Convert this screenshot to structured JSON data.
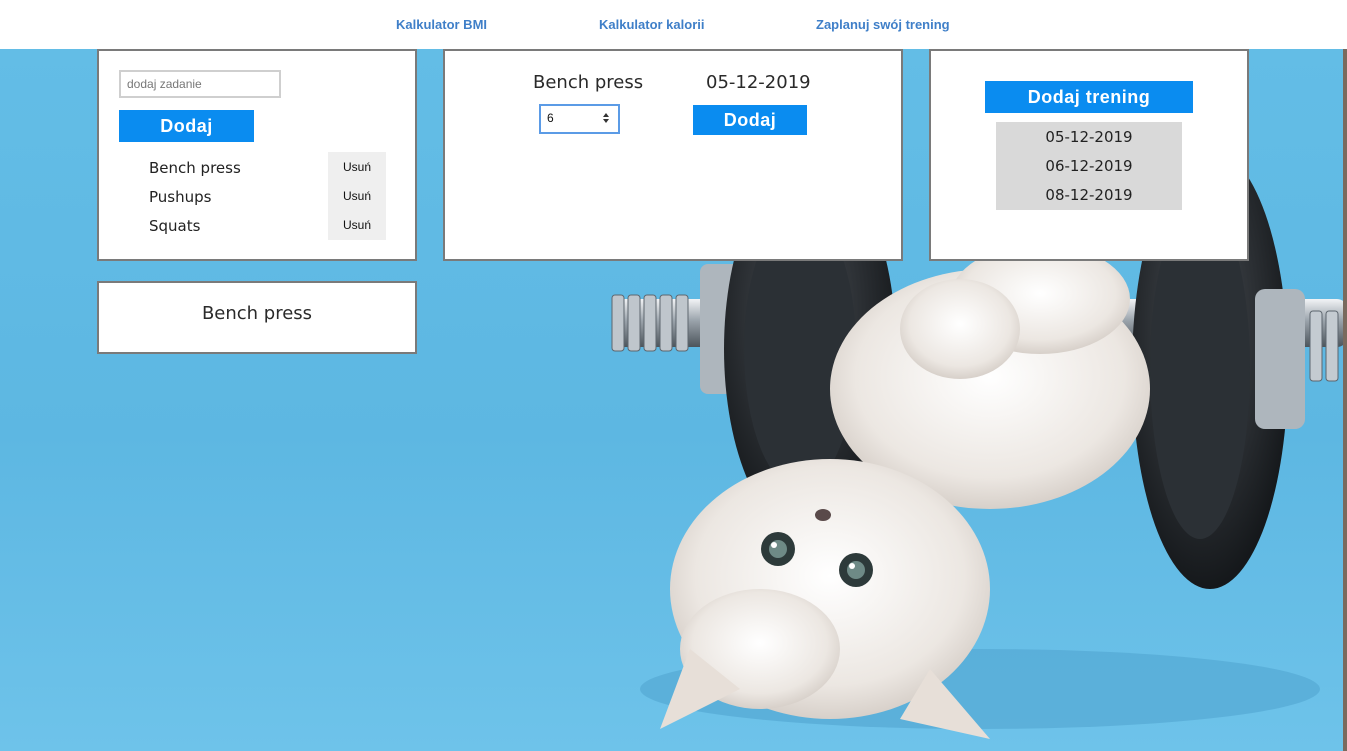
{
  "nav": {
    "bmi": "Kalkulator BMI",
    "calories": "Kalkulator kalorii",
    "plan": "Zaplanuj swój trening"
  },
  "tasks": {
    "input_placeholder": "dodaj zadanie",
    "add_label": "Dodaj",
    "items": [
      {
        "name": "Bench press",
        "delete_label": "Usuń"
      },
      {
        "name": "Pushups",
        "delete_label": "Usuń"
      },
      {
        "name": "Squats",
        "delete_label": "Usuń"
      }
    ]
  },
  "exercise": {
    "name": "Bench press",
    "date": "05-12-2019",
    "count_value": "6",
    "add_label": "Dodaj"
  },
  "trainings": {
    "add_label": "Dodaj trening",
    "dates": [
      "05-12-2019",
      "06-12-2019",
      "08-12-2019"
    ]
  },
  "selected": {
    "title": "Bench press"
  },
  "colors": {
    "accent": "#0a8cf0",
    "nav_link": "#3f7fc8",
    "background": "#5db7e2",
    "panel_border": "#7a7a7a"
  },
  "background_image": "kitten-lifting-dumbbell"
}
